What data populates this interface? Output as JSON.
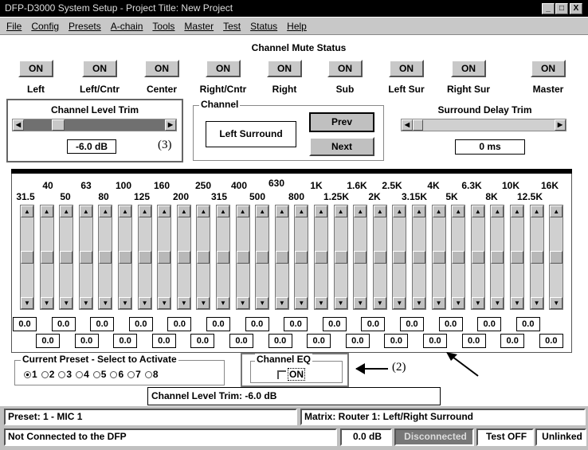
{
  "window": {
    "title": "DFP-D3000 System Setup - Project Title: New Project",
    "minimize": "_",
    "maximize": "□",
    "close": "X"
  },
  "menu": [
    "File",
    "Config",
    "Presets",
    "A-chain",
    "Tools",
    "Master",
    "Test",
    "Status",
    "Help"
  ],
  "mute": {
    "title": "Channel Mute Status",
    "channels": [
      {
        "label": "Left",
        "state": "ON"
      },
      {
        "label": "Left/Cntr",
        "state": "ON"
      },
      {
        "label": "Center",
        "state": "ON"
      },
      {
        "label": "Right/Cntr",
        "state": "ON"
      },
      {
        "label": "Right",
        "state": "ON"
      },
      {
        "label": "Sub",
        "state": "ON"
      },
      {
        "label": "Left Sur",
        "state": "ON"
      },
      {
        "label": "Right Sur",
        "state": "ON"
      },
      {
        "label": "Master",
        "state": "ON"
      }
    ]
  },
  "level_trim": {
    "title": "Channel Level Trim",
    "value": "-6.0 dB",
    "position": 0.22,
    "annotation": "(3)"
  },
  "channel": {
    "title": "Channel",
    "name": "Left Surround",
    "prev": "Prev",
    "next": "Next"
  },
  "surround_delay": {
    "title": "Surround  Delay Trim",
    "value": "0 ms",
    "position": 0.0
  },
  "eq": {
    "freqs_top": [
      "40",
      "63",
      "100",
      "160",
      "250",
      "400",
      "630",
      "1K",
      "1.6K",
      "2.5K",
      "4K",
      "6.3K",
      "10K",
      "16K"
    ],
    "freqs_bottom": [
      "31.5",
      "50",
      "80",
      "125",
      "200",
      "315",
      "500",
      "800",
      "1.25K",
      "2K",
      "3.15K",
      "5K",
      "8K",
      "12.5K"
    ],
    "slider_positions": [
      0.5,
      0.5,
      0.5,
      0.5,
      0.5,
      0.5,
      0.5,
      0.5,
      0.5,
      0.5,
      0.5,
      0.5,
      0.5,
      0.5,
      0.5,
      0.5,
      0.5,
      0.5,
      0.5,
      0.5,
      0.5,
      0.5,
      0.5,
      0.5,
      0.5,
      0.5,
      0.5,
      0.5
    ],
    "values_row1": [
      "0.0",
      "0.0",
      "0.0",
      "0.0",
      "0.0",
      "0.0",
      "0.0",
      "0.0",
      "0.0",
      "0.0",
      "0.0",
      "0.0",
      "0.0",
      "0.0"
    ],
    "values_row2": [
      "0.0",
      "0.0",
      "0.0",
      "0.0",
      "0.0",
      "0.0",
      "0.0",
      "0.0",
      "0.0",
      "0.0",
      "0.0",
      "0.0",
      "0.0",
      "0.0"
    ]
  },
  "preset": {
    "title": "Current Preset - Select to Activate",
    "options": [
      "1",
      "2",
      "3",
      "4",
      "5",
      "6",
      "7",
      "8"
    ],
    "selected": "1"
  },
  "channel_eq": {
    "title": "Channel EQ",
    "checkbox_label": "ON",
    "annotation": "(2)"
  },
  "trim_status": "Channel Level Trim:  -6.0 dB",
  "status": {
    "preset": "Preset: 1 -   MIC 1",
    "matrix": "Matrix: Router  1: Left/Right Surround",
    "connection": "Not Connected to the DFP",
    "level": "0.0 dB",
    "state": "Disconnected",
    "test": "Test OFF",
    "link": "Unlinked"
  }
}
